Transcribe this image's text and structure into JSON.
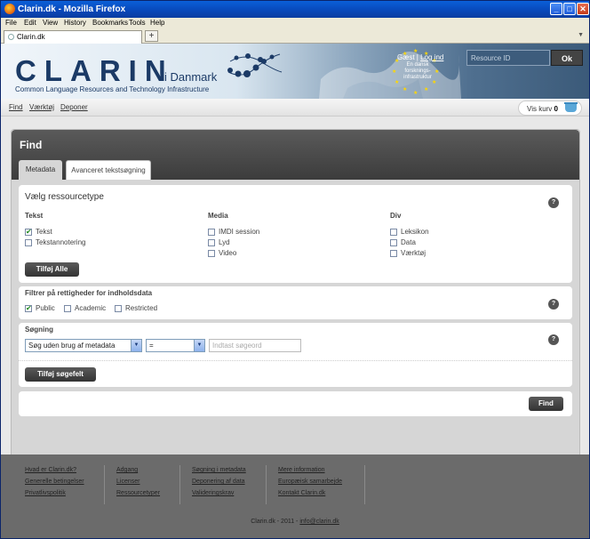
{
  "window": {
    "title": "Clarin.dk - Mozilla Firefox"
  },
  "menu": [
    "File",
    "Edit",
    "View",
    "History",
    "Bookmarks",
    "Tools",
    "Help"
  ],
  "browser_tab": {
    "label": "Clarin.dk"
  },
  "header": {
    "logo": "CLARIN",
    "logo_suffix": "i Danmark",
    "subtitle": "Common Language Resources and Technology Infrastructure",
    "guest": "Gæst",
    "login": "Log ind",
    "badge": "En dansk forsknings- infrastruktur",
    "resource_placeholder": "Resource ID",
    "ok": "Ok"
  },
  "nav": {
    "find": "Find",
    "tools": "Værktøj",
    "deposit": "Deponer",
    "cart_label": "Vis kurv",
    "cart_count": "0"
  },
  "panel": {
    "title": "Find",
    "tabs": [
      "Metadata",
      "Avanceret tekstsøgning"
    ],
    "resource_type": {
      "title": "Vælg ressourcetype",
      "col_text": "Tekst",
      "col_media": "Media",
      "col_div": "Div",
      "text_items": [
        "Tekst",
        "Tekstannotering"
      ],
      "media_items": [
        "IMDI session",
        "Lyd",
        "Video"
      ],
      "div_items": [
        "Leksikon",
        "Data",
        "Værktøj"
      ],
      "add_all": "Tilføj Alle"
    },
    "rights": {
      "title": "Filtrer på rettigheder for indholdsdata",
      "options": [
        "Public",
        "Academic",
        "Restricted"
      ]
    },
    "search": {
      "title": "Søgning",
      "field_select": "Søg uden brug af metadata",
      "op_select": "=",
      "term_placeholder": "Indtast søgeord",
      "add_field": "Tilføj søgefelt"
    },
    "find_button": "Find",
    "help": "?"
  },
  "footer": {
    "col1": [
      "Hvad er Clarin.dk?",
      "Generelle betingelser",
      "Privatlivspolitik"
    ],
    "col2": [
      "Adgang",
      "Licenser",
      "Ressourcetyper"
    ],
    "col3": [
      "Søgning i metadata",
      "Deponering af data",
      "Valideringskrav"
    ],
    "col4": [
      "Mere information",
      "Europæisk samarbejde",
      "Kontakt Clarin.dk"
    ],
    "copyright": "Clarin.dk - 2011 - ",
    "email": "info@clarin.dk"
  }
}
